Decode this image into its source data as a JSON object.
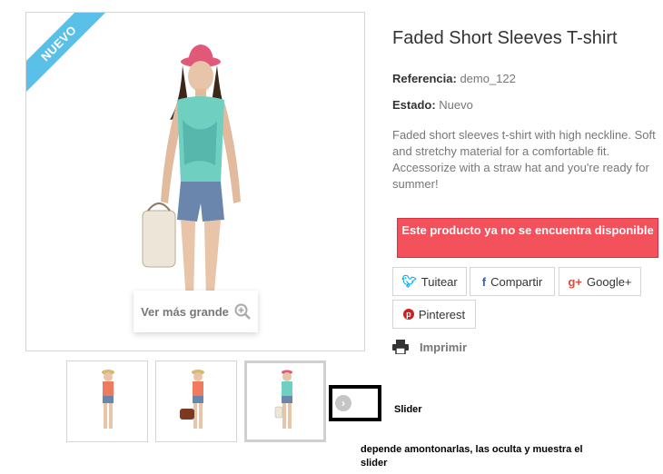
{
  "ribbon": {
    "label": "NUEVO"
  },
  "zoom": {
    "label": "Ver más grande"
  },
  "product": {
    "title": "Faded Short Sleeves T-shirt",
    "reference_label": "Referencia:",
    "reference_value": "demo_122",
    "condition_label": "Estado:",
    "condition_value": "Nuevo",
    "description": "Faded short sleeves t-shirt with high neckline. Soft and stretchy material for a comfortable fit. Accessorize with a straw hat and you're ready for summer!",
    "unavailable_notice": "Este producto ya no se encuentra disponible"
  },
  "share": {
    "twitter": "Tuitear",
    "facebook": "Compartir",
    "google": "Google+",
    "pinterest": "Pinterest"
  },
  "print": {
    "label": "Imprimir"
  },
  "slider": {
    "label": "Slider",
    "note": "depende amontonarlas, las oculta y muestra el slider"
  },
  "colors": {
    "ribbon": "#5bc0e8",
    "unavailable_bg": "#f3515c",
    "twitter": "#00aced",
    "facebook": "#435f9f",
    "google": "#e04b34",
    "pinterest": "#ce1f21"
  },
  "icons": [
    "zoom-in-icon",
    "twitter-icon",
    "facebook-icon",
    "google-plus-icon",
    "pinterest-icon",
    "printer-icon",
    "chevron-right-icon"
  ]
}
